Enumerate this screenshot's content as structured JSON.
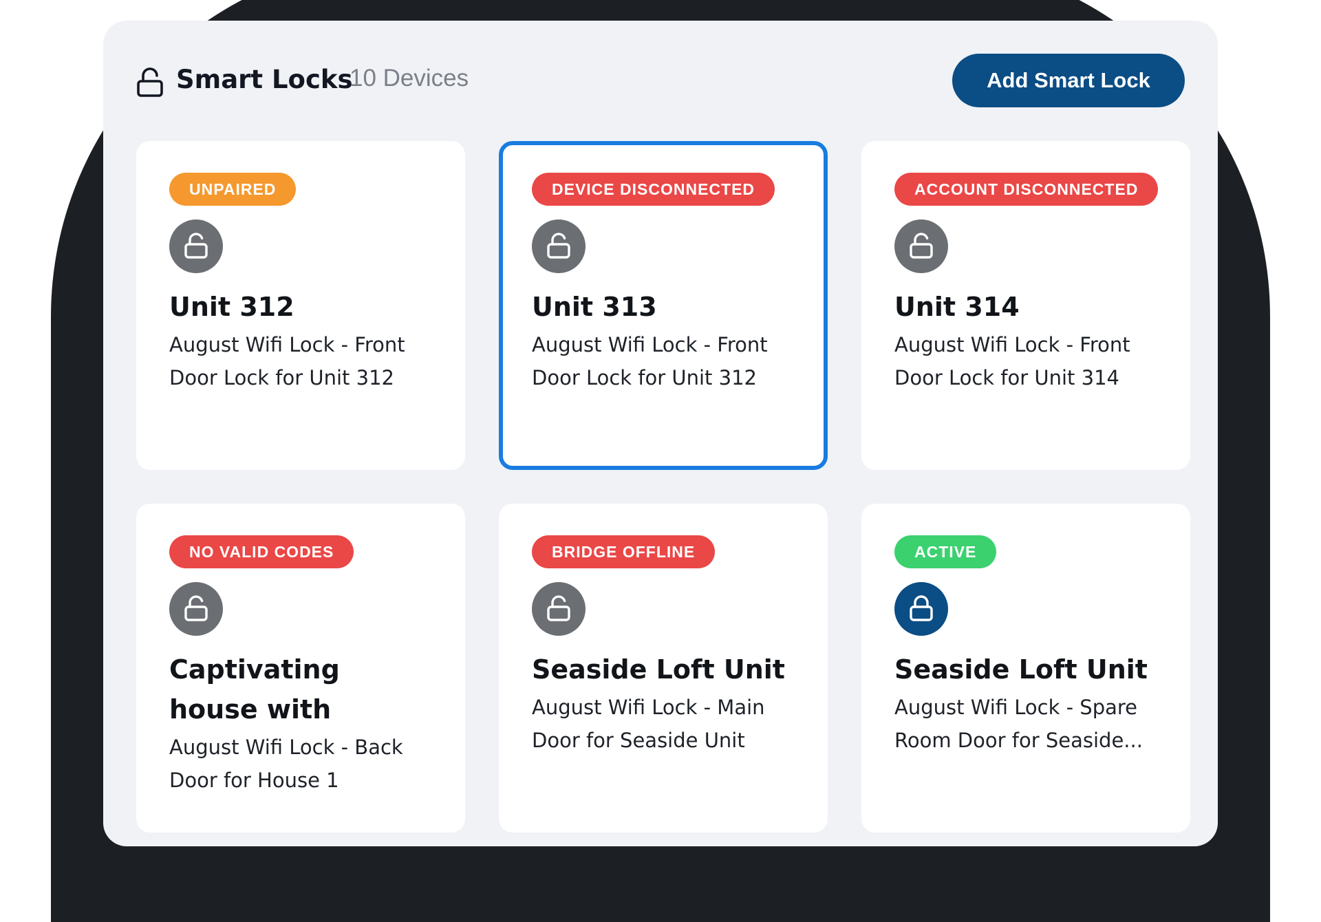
{
  "header": {
    "title": "Smart Locks",
    "count": "10 Devices",
    "add_button_label": "Add Smart Lock"
  },
  "colors": {
    "primary": "#0b4d85",
    "selected_border": "#1a7ce0",
    "status_orange": "#f5982d",
    "status_red": "#ea4747",
    "status_green": "#3bd16f",
    "lock_inactive": "#6b6e72",
    "lock_active": "#0b4d85"
  },
  "cards": [
    {
      "status": "UNPAIRED",
      "status_color": "#f5982d",
      "title": "Unit 312",
      "description": "August Wifi Lock - Front Door Lock for Unit 312",
      "icon": "unlocked-icon",
      "lock_color": "#6b6e72",
      "selected": false
    },
    {
      "status": "DEVICE DISCONNECTED",
      "status_color": "#ea4747",
      "title": "Unit 313",
      "description": "August Wifi Lock - Front Door Lock for Unit 312",
      "icon": "unlocked-icon",
      "lock_color": "#6b6e72",
      "selected": true
    },
    {
      "status": "ACCOUNT DISCONNECTED",
      "status_color": "#ea4747",
      "title": "Unit 314",
      "description": "August Wifi Lock - Front Door Lock for Unit 314",
      "icon": "unlocked-icon",
      "lock_color": "#6b6e72",
      "selected": false
    },
    {
      "status": "NO VALID CODES",
      "status_color": "#ea4747",
      "title": "Captivating house with gorgeous p...",
      "description": "August Wifi Lock - Back Door for House 1",
      "icon": "unlocked-icon",
      "lock_color": "#6b6e72",
      "selected": false
    },
    {
      "status": "BRIDGE OFFLINE",
      "status_color": "#ea4747",
      "title": "Seaside Loft Unit",
      "description": "August Wifi Lock - Main Door for Seaside Unit",
      "icon": "unlocked-icon",
      "lock_color": "#6b6e72",
      "selected": false
    },
    {
      "status": "ACTIVE",
      "status_color": "#3bd16f",
      "title": "Seaside Loft Unit",
      "description": "August Wifi Lock - Spare Room Door for Seaside...",
      "icon": "locked-icon",
      "lock_color": "#0b4d85",
      "selected": false
    }
  ]
}
